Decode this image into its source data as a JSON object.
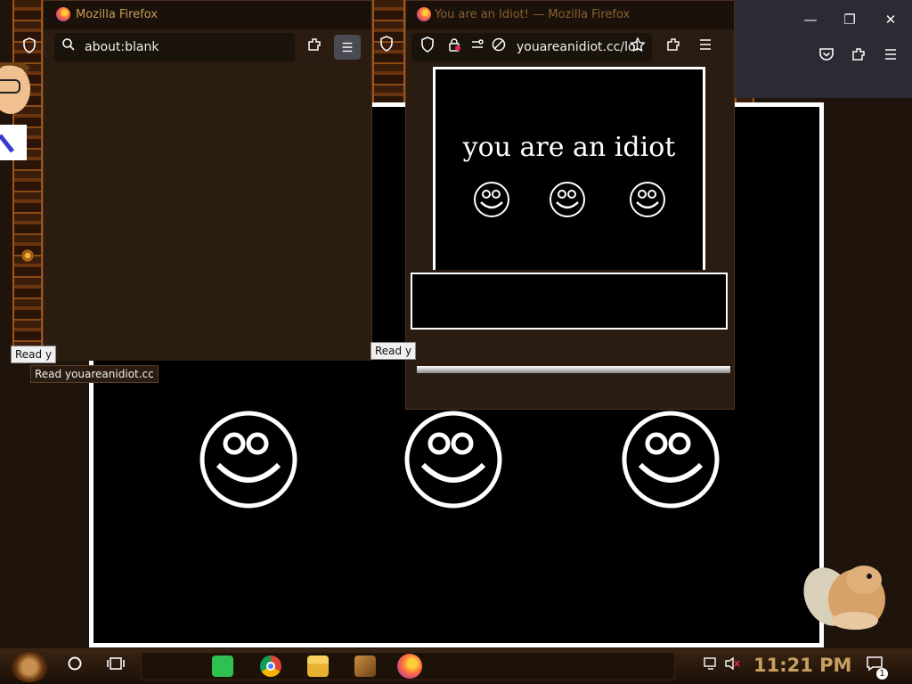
{
  "background_window": {
    "controls": {
      "minimize": "—",
      "maximize": "❐",
      "close": "✕"
    }
  },
  "left_popup": {
    "title": "Mozilla Firefox",
    "url": "about:blank"
  },
  "right_popup": {
    "title": "You are an Idiot! — Mozilla Firefox",
    "url": "youareanidiot.cc/lol.",
    "page_text": "you are an idiot"
  },
  "tooltips": {
    "read_left": "Read y",
    "read_main": "Read youareanidiot.cc",
    "read_mid": "Read y"
  },
  "taskbar": {
    "clock": "11:21 PM",
    "notification_count": "1"
  },
  "colors": {
    "accent": "#c8a060",
    "popup_bg": "#2a1c10",
    "content_bg": "#000000"
  }
}
